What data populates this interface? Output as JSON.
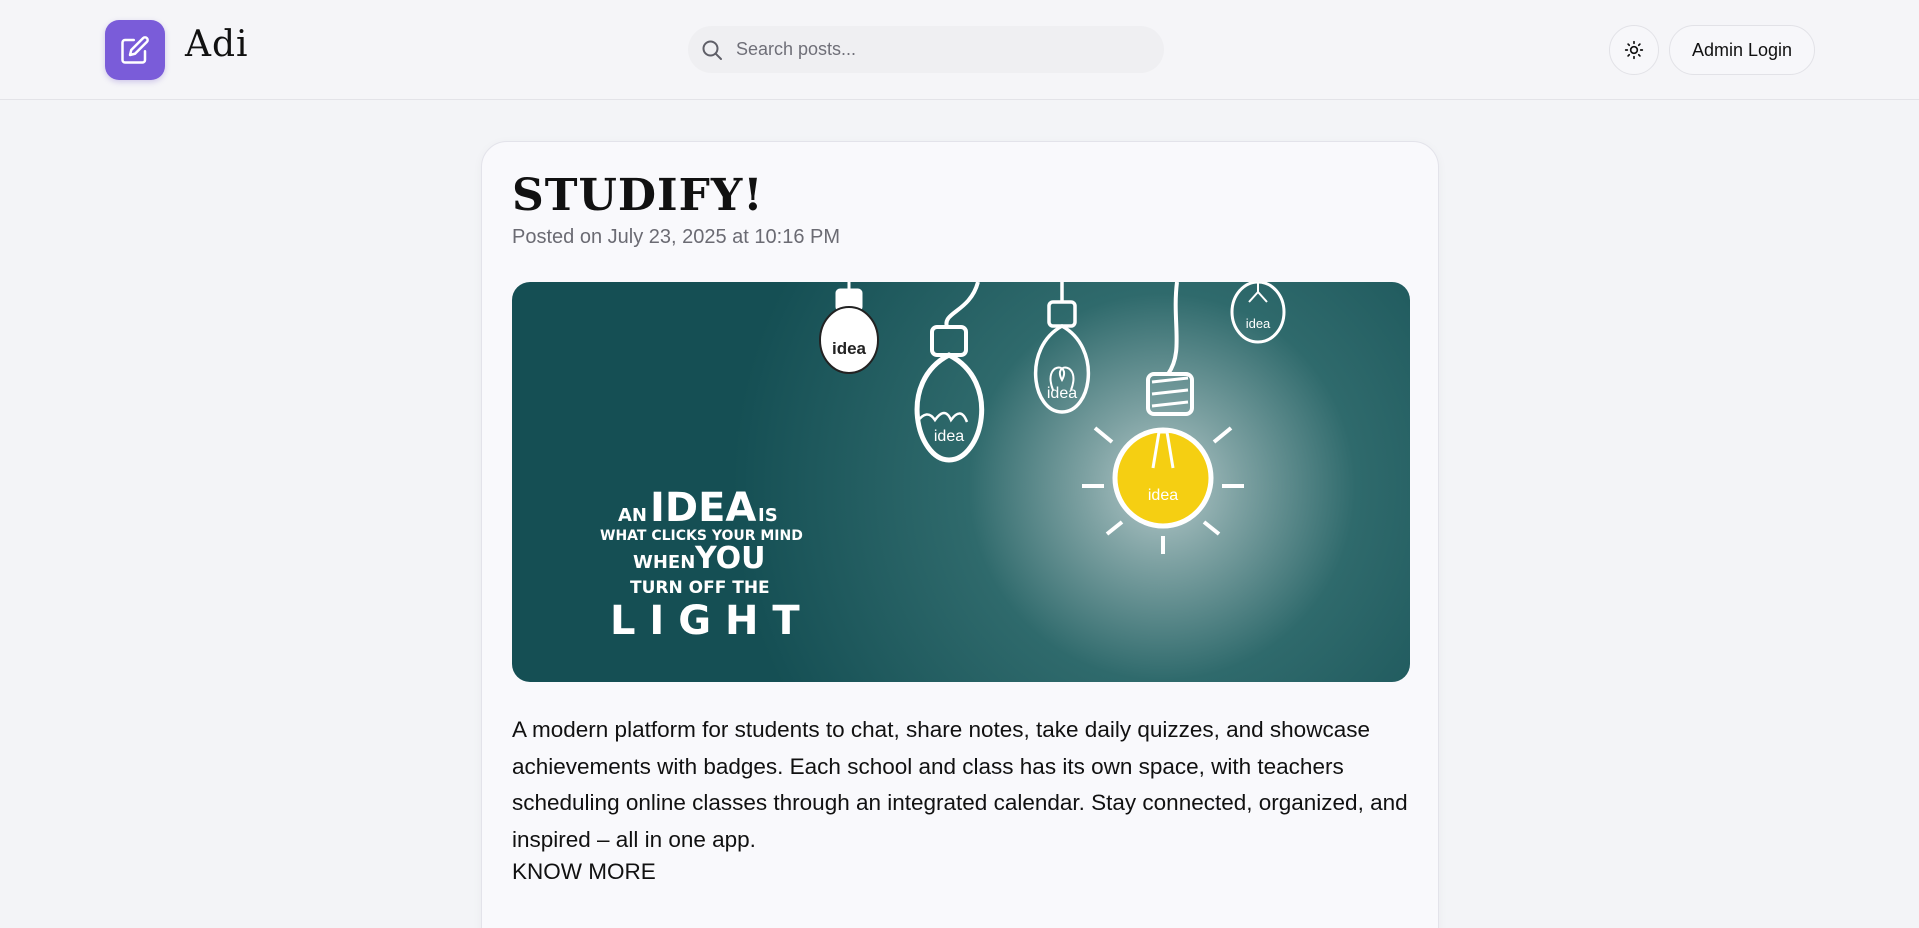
{
  "header": {
    "brand": "Adi",
    "search_placeholder": "Search posts...",
    "admin_login": "Admin Login"
  },
  "post": {
    "title": "STUDIFY!",
    "meta": "Posted on July 23, 2025 at 10:16 PM",
    "image": {
      "quote_line1_a": "AN",
      "quote_line1_b": "IDEA",
      "quote_line1_c": "IS",
      "quote_line2": "WHAT CLICKS YOUR MIND",
      "quote_line3_a": "WHEN",
      "quote_line3_b": "YOU",
      "quote_line4": "TURN OFF THE",
      "quote_line5": "L I G H T",
      "bulb_label": "idea"
    },
    "body": "A modern platform for students to chat, share notes, take daily quizzes, and showcase achievements with badges. Each school and class has its own space, with teachers scheduling online classes through an integrated calendar. Stay connected, organized, and inspired – all in one app.",
    "know_more": "KNOW MORE"
  },
  "colors": {
    "accent": "#7a5cd9",
    "hero_bg": "#1b5a5e",
    "bulb_yellow": "#f5cf12"
  }
}
